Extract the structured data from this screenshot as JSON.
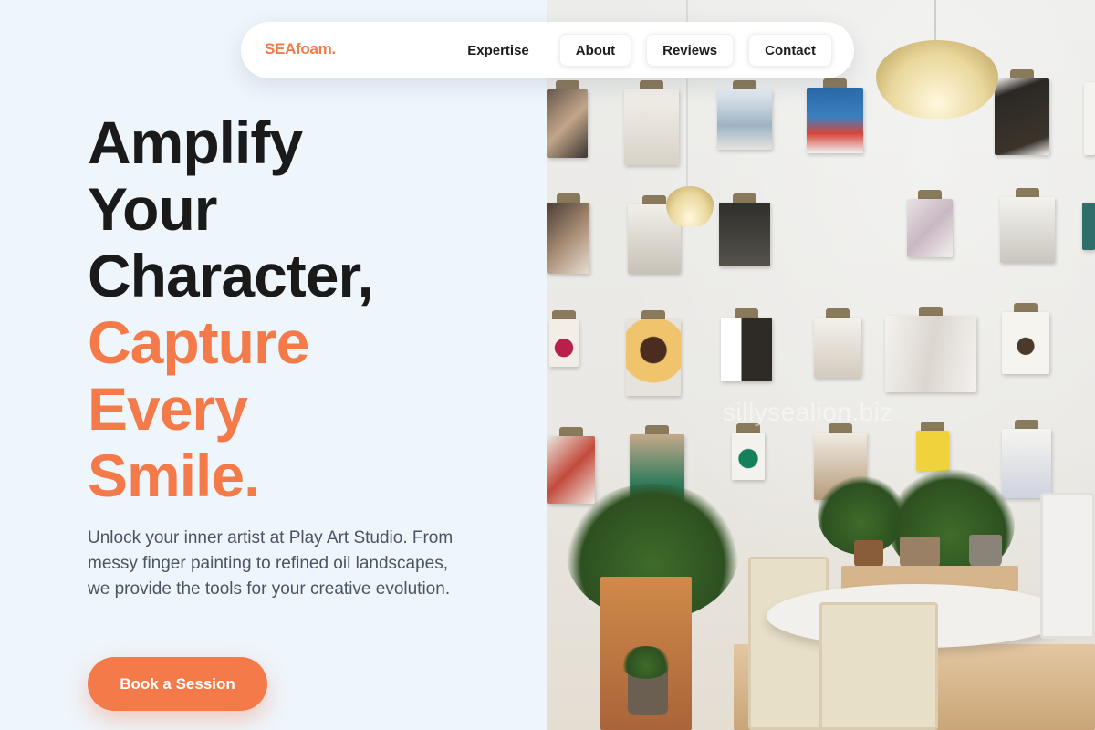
{
  "brand": {
    "logo": "SEAfoam.",
    "accent_color": "#f47a4a"
  },
  "nav": {
    "items": [
      {
        "label": "Expertise"
      },
      {
        "label": "About"
      },
      {
        "label": "Reviews"
      },
      {
        "label": "Contact"
      }
    ]
  },
  "hero": {
    "headline_lines": [
      "Amplify",
      "Your",
      "Character,"
    ],
    "accent_lines": [
      "Capture",
      "Every",
      "Smile."
    ],
    "description": "Unlock your inner artist at Play Art Studio. From messy finger painting to refined oil landscapes, we provide the tools for your creative evolution.",
    "cta_label": "Book a Session"
  },
  "photo": {
    "watermark": "sillysealion.biz"
  }
}
